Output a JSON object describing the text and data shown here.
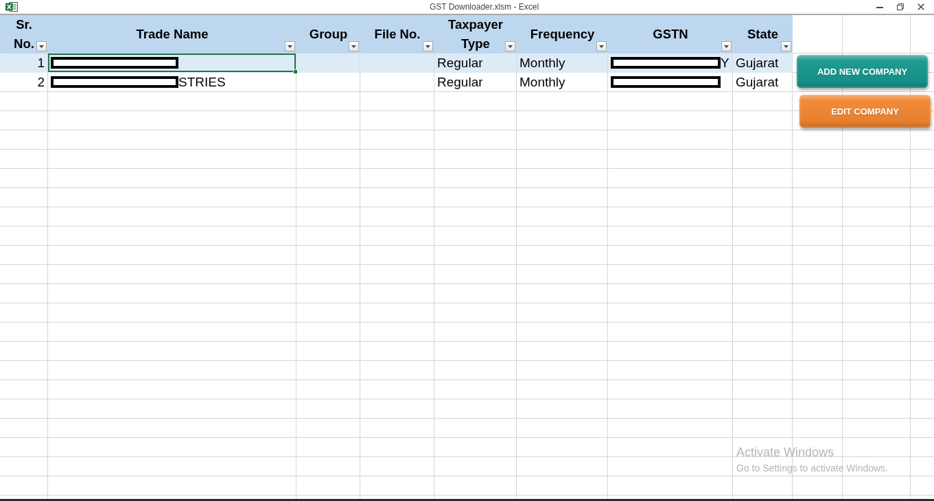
{
  "window": {
    "title": "GST Downloader.xlsm - Excel"
  },
  "table": {
    "columns": [
      {
        "label": "Sr. No.",
        "kind": "number"
      },
      {
        "label": "Trade Name",
        "kind": "text"
      },
      {
        "label": "Group",
        "kind": "text"
      },
      {
        "label": "File No.",
        "kind": "text"
      },
      {
        "label": "Taxpayer Type",
        "kind": "text"
      },
      {
        "label": "Frequency",
        "kind": "text"
      },
      {
        "label": "GSTN",
        "kind": "text"
      },
      {
        "label": "State",
        "kind": "text"
      }
    ],
    "rows": [
      {
        "cells": [
          {
            "text": "1",
            "redacted": false,
            "selected": false
          },
          {
            "redacted": true,
            "selected": true
          },
          {
            "redacted": false,
            "selected": false
          },
          {
            "redacted": false,
            "selected": false
          },
          {
            "text": "Regular",
            "redacted": false,
            "selected": false
          },
          {
            "text": "Monthly",
            "redacted": false,
            "selected": false
          },
          {
            "text": "Y",
            "redacted": true,
            "selected": false
          },
          {
            "text": "Gujarat",
            "redacted": false,
            "selected": false
          }
        ]
      },
      {
        "cells": [
          {
            "text": "2",
            "redacted": false,
            "selected": false
          },
          {
            "text": "STRIES",
            "redacted": true,
            "selected": false
          },
          {
            "redacted": false,
            "selected": false
          },
          {
            "redacted": false,
            "selected": false
          },
          {
            "text": "Regular",
            "redacted": false,
            "selected": false
          },
          {
            "text": "Monthly",
            "redacted": false,
            "selected": false
          },
          {
            "redacted": true,
            "selected": false
          },
          {
            "text": "Gujarat",
            "redacted": false,
            "selected": false
          }
        ]
      }
    ]
  },
  "buttons": [
    {
      "label": "ADD NEW COMPANY",
      "color": "#14968b"
    },
    {
      "label": "EDIT COMPANY",
      "color": "#f08530"
    }
  ],
  "os_overlay": {
    "title": "Activate Windows",
    "message": "Go to Settings to activate Windows."
  }
}
